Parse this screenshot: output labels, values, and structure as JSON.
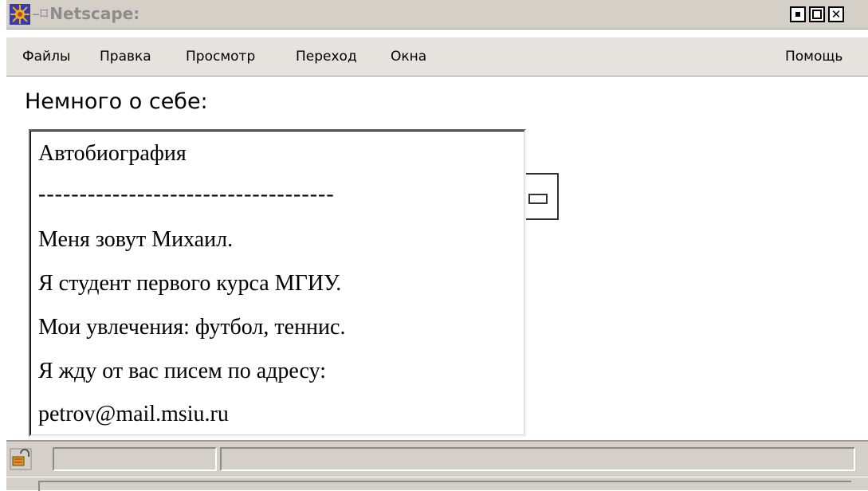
{
  "window": {
    "title_prefix": "–⌑",
    "title": "Netscape:",
    "buttons": {
      "minimize": "minimize",
      "maximize": "maximize",
      "close": "✕"
    }
  },
  "menu": {
    "items": [
      "Файлы",
      "Правка",
      "Просмотр",
      "Переход",
      "Окна"
    ],
    "help": "Помощь"
  },
  "content": {
    "heading": "Немного о себе:",
    "textarea_lines": [
      "Автобиография",
      "------------------------------------",
      "Меня зовут Михаил.",
      "Я студент первого курса МГИУ.",
      "Мои увлечения: футбол, теннис.",
      "Я жду от вас писем по адресу:",
      "petrov@mail.msiu.ru"
    ]
  },
  "statusbar": {
    "security_icon": "padlock-open-icon"
  },
  "colors": {
    "chrome": "#d4d0c8",
    "menubar": "#e6e3de",
    "title_text": "#8c8c8c"
  }
}
